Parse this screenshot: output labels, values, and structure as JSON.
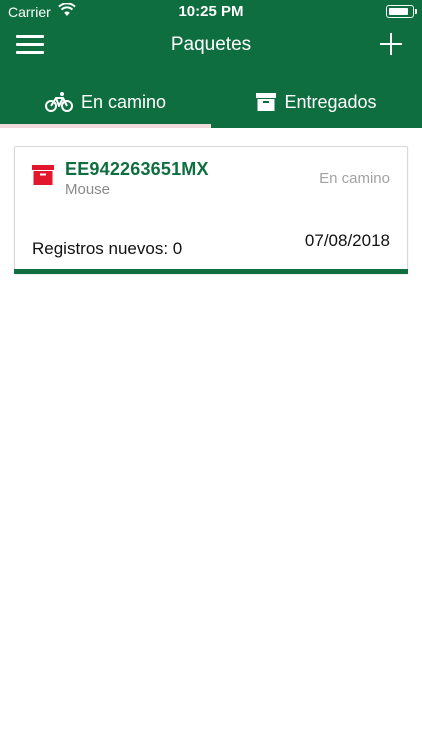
{
  "status_bar": {
    "carrier": "Carrier",
    "time": "10:25 PM",
    "battery_level": 0.9
  },
  "nav": {
    "title": "Paquetes",
    "menu_icon": "hamburger-icon",
    "add_icon": "plus-icon"
  },
  "tabs": [
    {
      "label": "En camino",
      "icon": "bicycle-icon",
      "selected": true
    },
    {
      "label": "Entregados",
      "icon": "archive-box-icon",
      "selected": false
    }
  ],
  "packages": [
    {
      "tracking_number": "EE942263651MX",
      "name": "Mouse",
      "status": "En camino",
      "records_label": "Registros nuevos: 0",
      "date": "07/08/2018",
      "icon": "package-icon"
    }
  ],
  "colors": {
    "primary_green": "#0f6e3f",
    "tab_indicator": "#f2d9dc",
    "package_icon_red": "#e2172d",
    "muted_text": "#8a8a8a"
  }
}
